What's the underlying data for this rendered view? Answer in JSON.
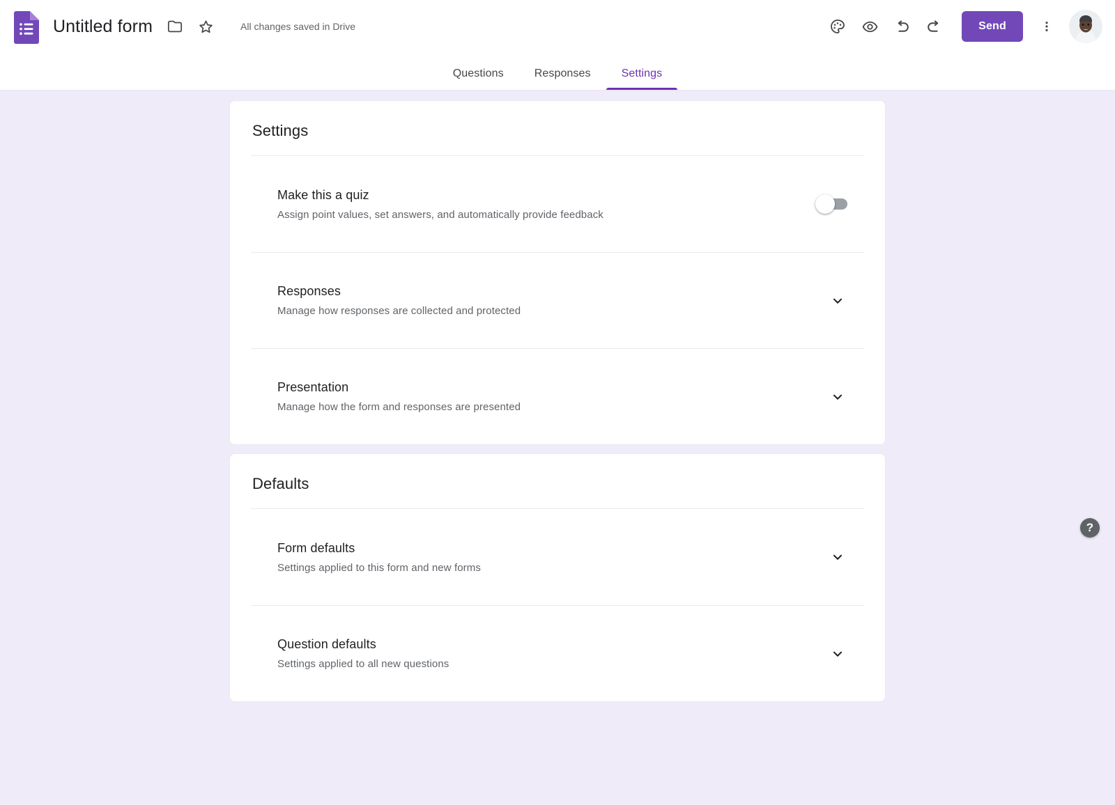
{
  "header": {
    "logo_icon": "google-forms-icon",
    "form_title": "Untitled form",
    "move_folder_icon": "folder-icon",
    "star_icon": "star-outline-icon",
    "save_status": "All changes saved in Drive",
    "theme_icon": "palette-icon",
    "preview_icon": "eye-icon",
    "undo_icon": "undo-icon",
    "redo_icon": "redo-icon",
    "send_label": "Send",
    "more_icon": "more-vert-icon",
    "avatar_name": "account-avatar"
  },
  "tabs": [
    {
      "label": "Questions",
      "active": false
    },
    {
      "label": "Responses",
      "active": false
    },
    {
      "label": "Settings",
      "active": true
    }
  ],
  "cards": [
    {
      "title": "Settings",
      "rows": [
        {
          "label": "Make this a quiz",
          "desc": "Assign point values, set answers, and automatically provide feedback",
          "control": "toggle",
          "toggle_on": false
        },
        {
          "label": "Responses",
          "desc": "Manage how responses are collected and protected",
          "control": "chevron",
          "expanded": false
        },
        {
          "label": "Presentation",
          "desc": "Manage how the form and responses are presented",
          "control": "chevron",
          "expanded": false
        }
      ]
    },
    {
      "title": "Defaults",
      "rows": [
        {
          "label": "Form defaults",
          "desc": "Settings applied to this form and new forms",
          "control": "chevron",
          "expanded": false
        },
        {
          "label": "Question defaults",
          "desc": "Settings applied to all new questions",
          "control": "chevron",
          "expanded": false
        }
      ]
    }
  ],
  "help": {
    "label": "?",
    "icon": "help-icon"
  },
  "colors": {
    "background": "#f0ebf8",
    "accent": "#6d31b0",
    "send_button": "#7248b9",
    "card": "#ffffff",
    "text_primary": "#202124",
    "text_secondary": "#5f6368",
    "divider": "#e8eaed",
    "toggle_off_track": "#9aa0a6",
    "logo_purple": "#7248b9"
  }
}
